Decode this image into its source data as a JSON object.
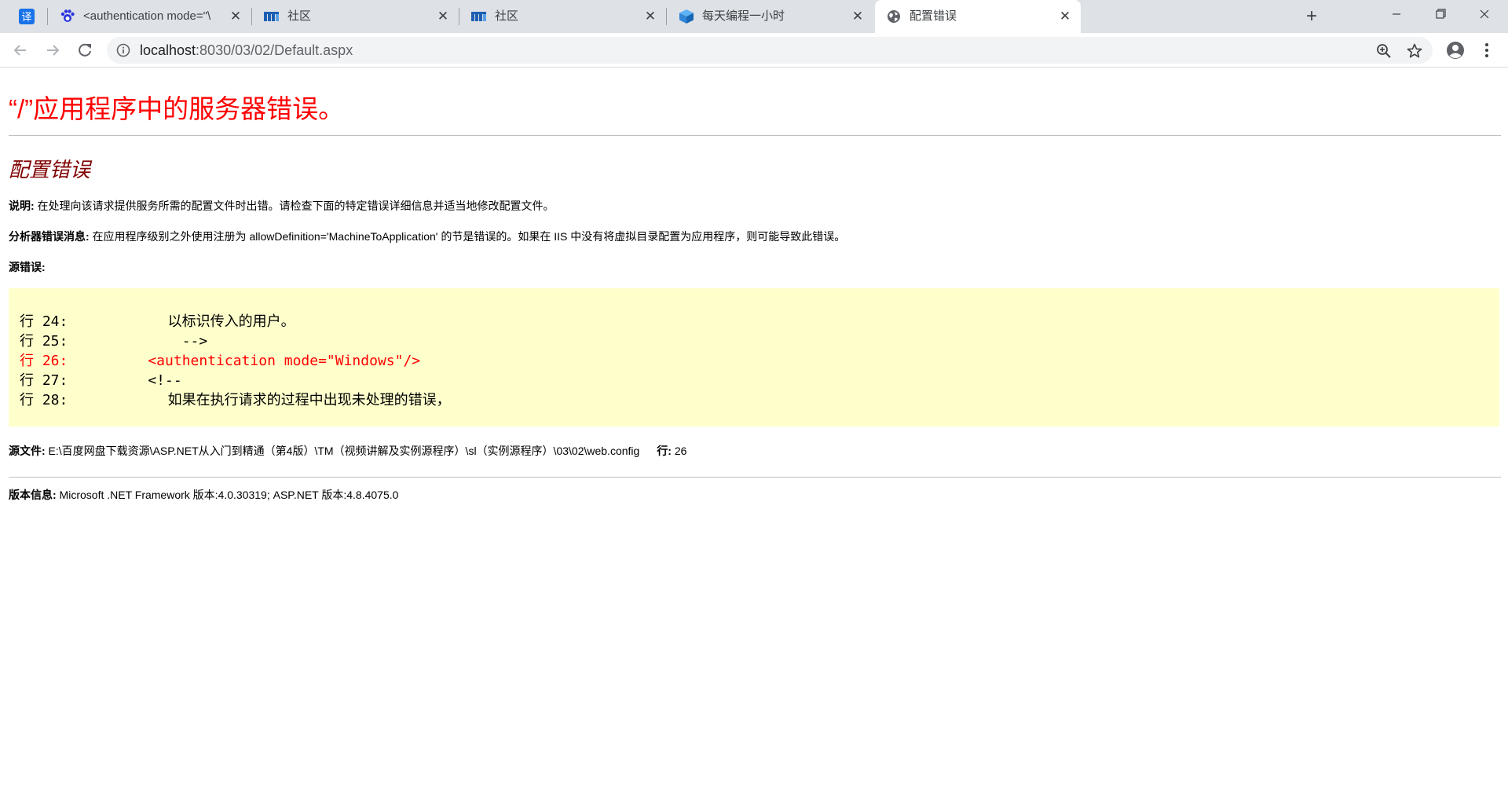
{
  "browser": {
    "tabs": [
      {
        "favicon": "translate-icon",
        "title": "",
        "favicon_text": "译"
      },
      {
        "favicon": "baidu-icon",
        "title": "<authentication mode=\"\\"
      },
      {
        "favicon": "community-logo-icon",
        "title": "社区"
      },
      {
        "favicon": "community-logo-icon",
        "title": "社区"
      },
      {
        "favicon": "cube-icon",
        "title": "每天编程一小时"
      },
      {
        "favicon": "globe-icon",
        "title": "配置错误",
        "active": true
      }
    ],
    "url_host": "localhost",
    "url_path": ":8030/03/02/Default.aspx"
  },
  "page": {
    "title": "“/”应用程序中的服务器错误。",
    "subtitle": "配置错误",
    "description_label": "说明:",
    "description_text": " 在处理向该请求提供服务所需的配置文件时出错。请检查下面的特定错误详细信息并适当地修改配置文件。",
    "parser_label": "分析器错误消息:",
    "parser_text": " 在应用程序级别之外使用注册为 allowDefinition='MachineToApplication' 的节是错误的。如果在 IIS 中没有将虚拟目录配置为应用程序，则可能导致此错误。",
    "source_error_label": "源错误:",
    "code_lines": [
      {
        "label": "行",
        "num": " 24:",
        "text": "            以标识传入的用户。",
        "error": false,
        "cjk": true
      },
      {
        "label": "行",
        "num": " 25:",
        "text": "        -->",
        "error": false,
        "cjk": false
      },
      {
        "label": "行",
        "num": " 26:",
        "text": "    <authentication mode=\"Windows\"/>",
        "error": true,
        "cjk": false
      },
      {
        "label": "行",
        "num": " 27:",
        "text": "    <!--",
        "error": false,
        "cjk": false
      },
      {
        "label": "行",
        "num": " 28:",
        "text": "            如果在执行请求的过程中出现未处理的错误，",
        "error": false,
        "cjk": true
      }
    ],
    "source_file_label": "源文件:",
    "source_file_text": " E:\\百度网盘下载资源\\ASP.NET从入门到精通（第4版）\\TM（视频讲解及实例源程序）\\sl（实例源程序）\\03\\02\\web.config",
    "line_label": "行:",
    "line_value": " 26",
    "version_label": "版本信息:",
    "version_text": " Microsoft .NET Framework 版本:4.0.30319; ASP.NET 版本:4.8.4075.0"
  }
}
